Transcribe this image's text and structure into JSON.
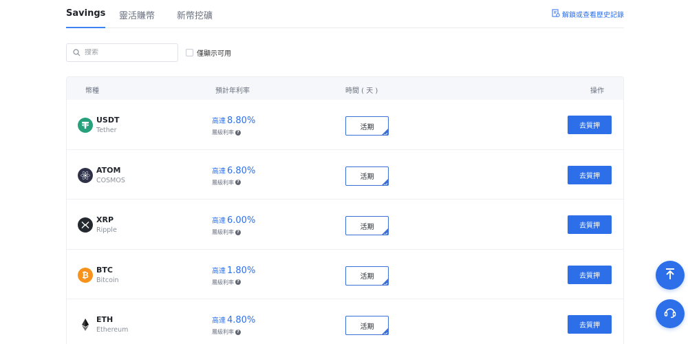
{
  "tabs": [
    {
      "label": "Savings",
      "active": true
    },
    {
      "label": "靈活賺幣",
      "active": false
    },
    {
      "label": "新幣挖礦",
      "active": false
    }
  ],
  "history_link": "解鎖或查看歷史記錄",
  "search": {
    "placeholder": "搜索",
    "value": ""
  },
  "available_only_label": "僅顯示可用",
  "table": {
    "headers": {
      "coin": "幣種",
      "rate": "預計年利率",
      "time": "時間 ( 天 )",
      "action": "操作"
    },
    "rows": [
      {
        "symbol": "USDT",
        "name": "Tether",
        "rate_prefix": "高達",
        "rate": "8.80%",
        "tier_label": "層級利率",
        "period": "活期",
        "action": "去質押",
        "icon": "usdt-icon",
        "icon_color": "#26a17b"
      },
      {
        "symbol": "ATOM",
        "name": "COSMOS",
        "rate_prefix": "高達",
        "rate": "6.80%",
        "tier_label": "層級利率",
        "period": "活期",
        "action": "去質押",
        "icon": "atom-icon",
        "icon_color": "#2e3148"
      },
      {
        "symbol": "XRP",
        "name": "Ripple",
        "rate_prefix": "高達",
        "rate": "6.00%",
        "tier_label": "層級利率",
        "period": "活期",
        "action": "去質押",
        "icon": "xrp-icon",
        "icon_color": "#23292f"
      },
      {
        "symbol": "BTC",
        "name": "Bitcoin",
        "rate_prefix": "高達",
        "rate": "1.80%",
        "tier_label": "層級利率",
        "period": "活期",
        "action": "去質押",
        "icon": "btc-icon",
        "icon_color": "#f7931a"
      },
      {
        "symbol": "ETH",
        "name": "Ethereum",
        "rate_prefix": "高達",
        "rate": "4.80%",
        "tier_label": "層級利率",
        "period": "活期",
        "action": "去質押",
        "icon": "eth-icon",
        "icon_color": "#3c3c3d"
      }
    ]
  },
  "colors": {
    "accent": "#2d6fe8",
    "tab_underline": "#3b82f6"
  },
  "floating": {
    "back_to_top": "arrow-up-icon",
    "support": "headset-icon"
  }
}
